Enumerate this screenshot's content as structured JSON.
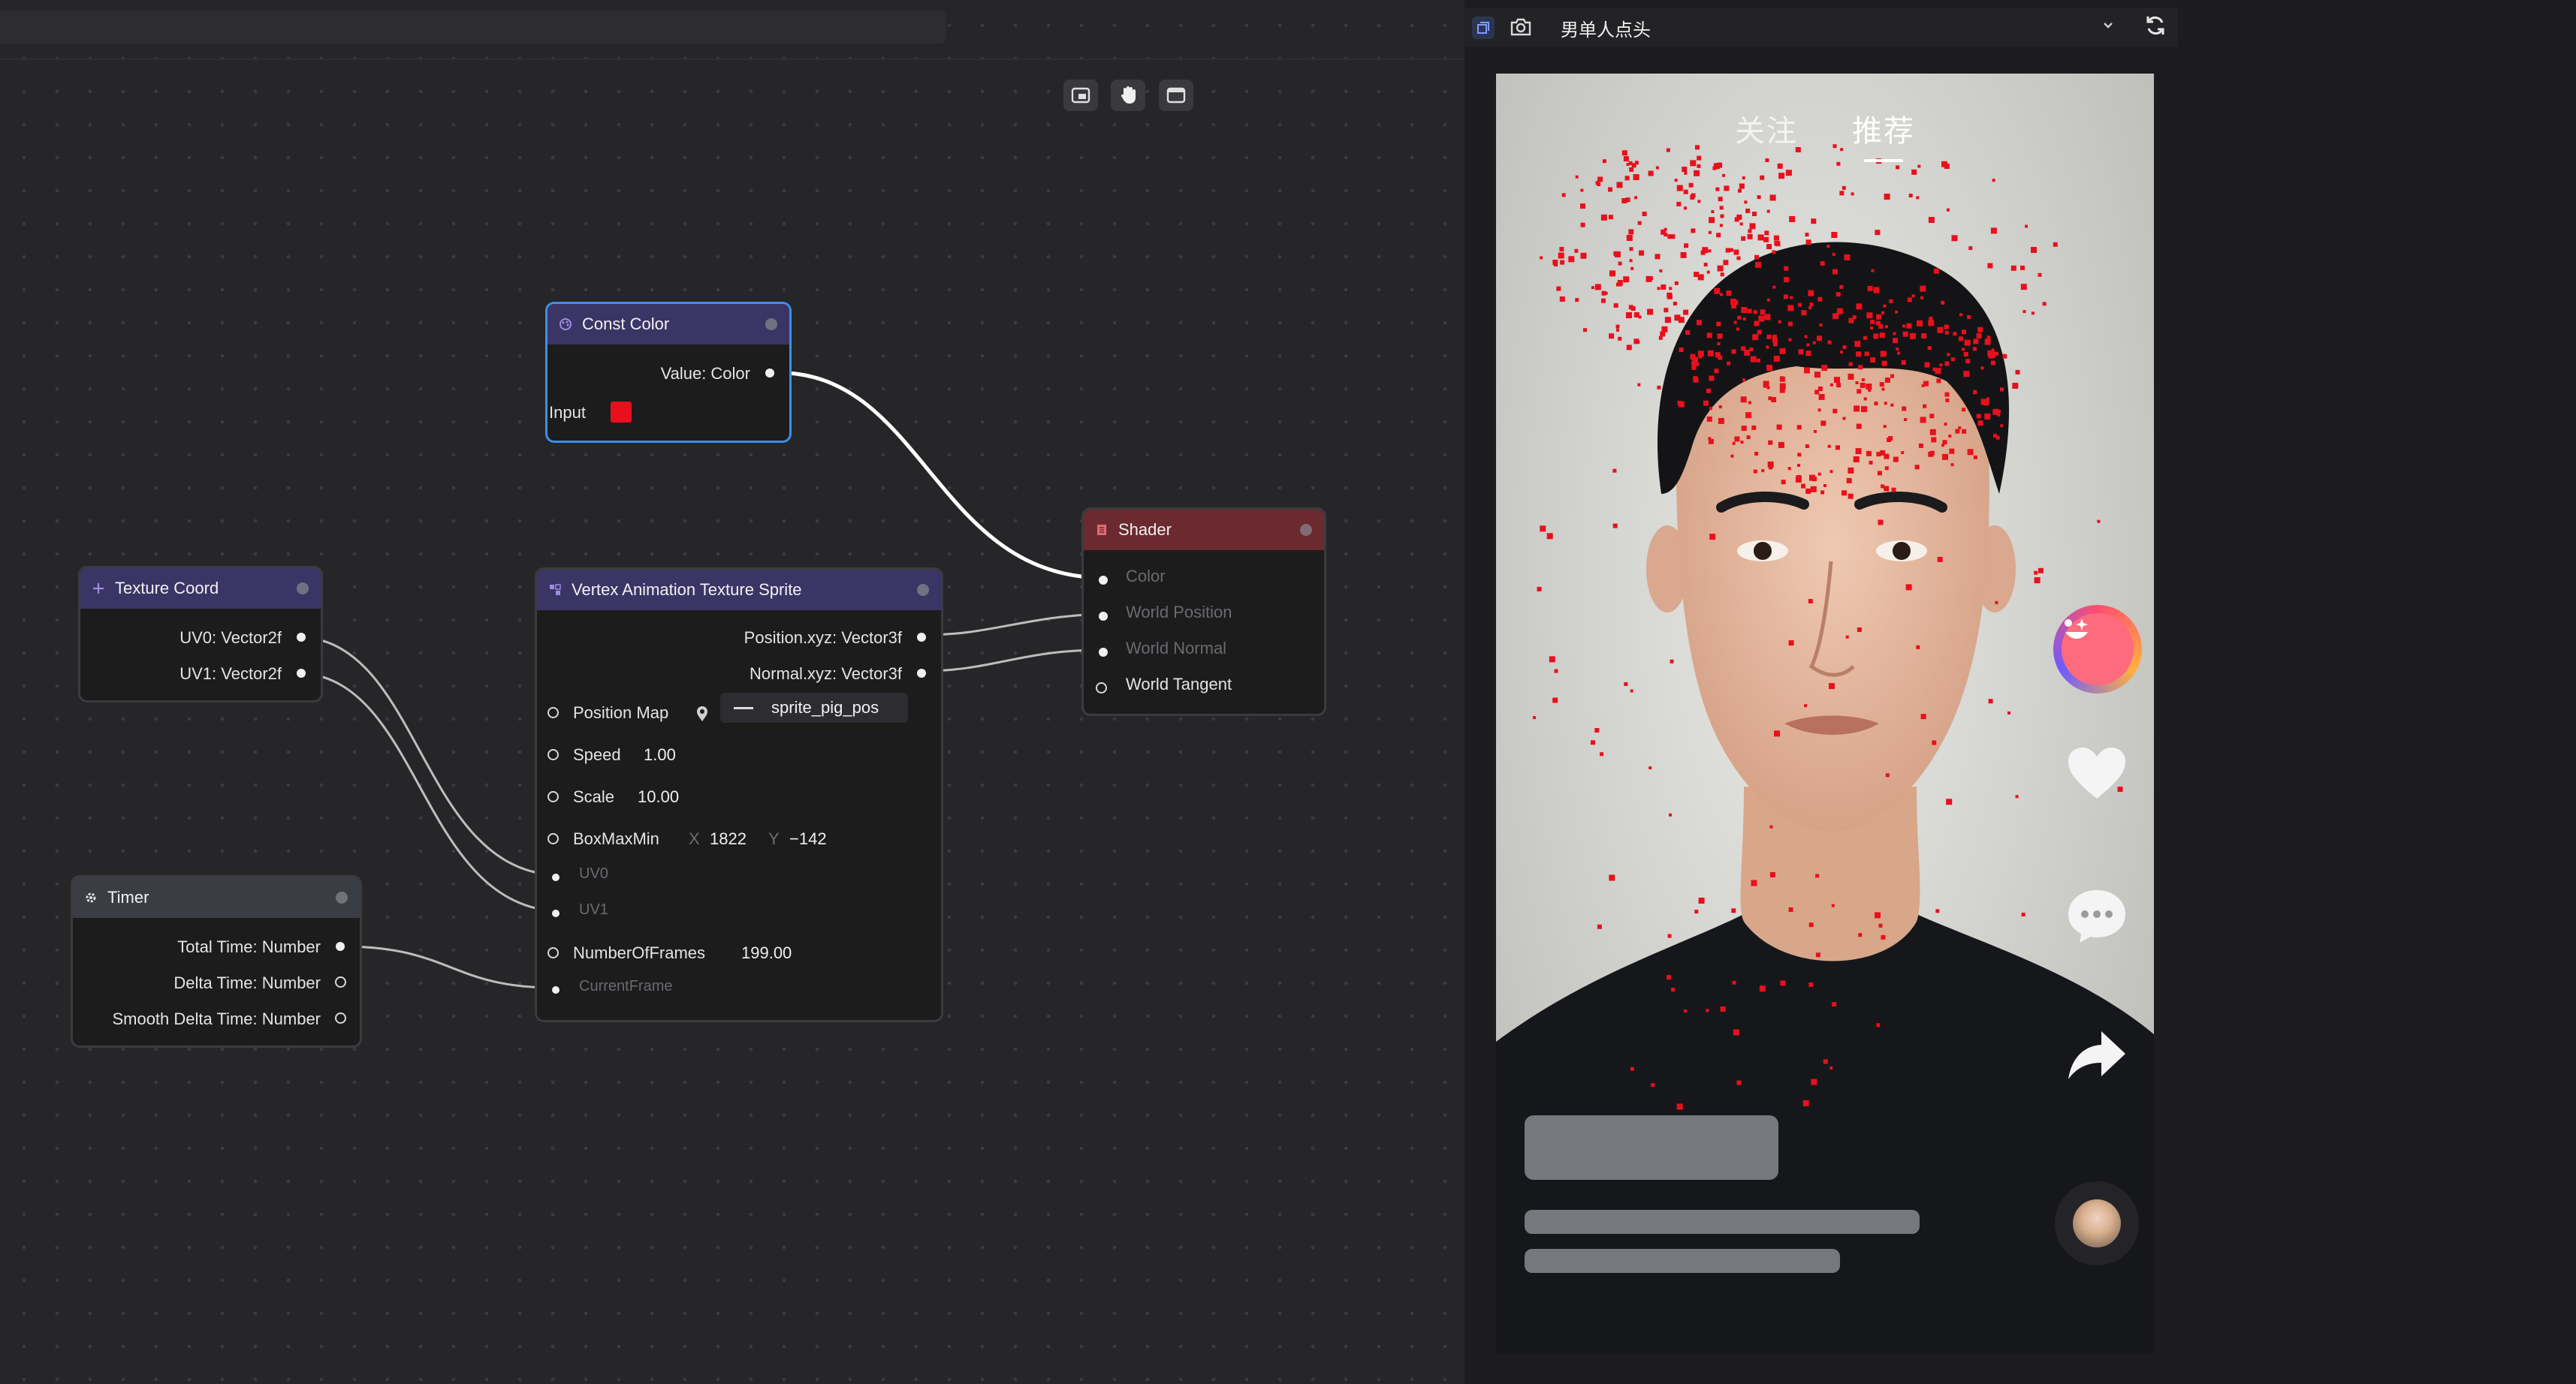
{
  "graph": {
    "toolbar": {
      "icons": [
        "frame-icon",
        "hand-icon",
        "window-icon"
      ]
    },
    "nodes": {
      "const_color": {
        "title": "Const Color",
        "output": "Value: Color",
        "input_label": "Input",
        "color": "#e8101c"
      },
      "texture_coord": {
        "title": "Texture Coord",
        "outputs": [
          "UV0: Vector2f",
          "UV1: Vector2f"
        ]
      },
      "vat_sprite": {
        "title": "Vertex Animation Texture Sprite",
        "outputs": [
          "Position.xyz: Vector3f",
          "Normal.xyz: Vector3f"
        ],
        "position_map_label": "Position Map",
        "position_map_value": "sprite_pig_pos",
        "speed_label": "Speed",
        "speed_value": "1.00",
        "scale_label": "Scale",
        "scale_value": "10.00",
        "boxmaxmin_label": "BoxMaxMin",
        "box_x_label": "X",
        "box_x_value": "1822",
        "box_y_label": "Y",
        "box_y_value": "−142",
        "uv0_label": "UV0",
        "uv1_label": "UV1",
        "frames_label": "NumberOfFrames",
        "frames_value": "199.00",
        "current_frame_label": "CurrentFrame"
      },
      "timer": {
        "title": "Timer",
        "outputs": [
          "Total Time: Number",
          "Delta Time: Number",
          "Smooth Delta Time: Number"
        ]
      },
      "shader": {
        "title": "Shader",
        "inputs": [
          "Color",
          "World Position",
          "World Normal",
          "World Tangent"
        ]
      }
    }
  },
  "preview": {
    "effect_name": "男单人点头",
    "tabs": [
      "关注",
      "推荐"
    ],
    "active_tab": "推荐",
    "side_icons": [
      "effect-avatar-icon",
      "heart-icon",
      "comment-icon",
      "share-icon",
      "music-disc-icon"
    ],
    "accent_color": "#e8101c"
  }
}
